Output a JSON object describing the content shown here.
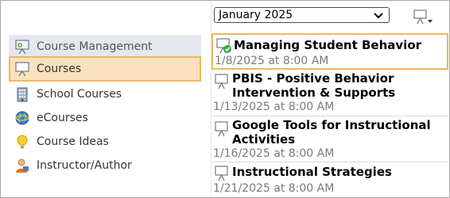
{
  "nav": {
    "header": "Course Management",
    "items": [
      "Courses",
      "School Courses",
      "eCourses",
      "Course Ideas",
      "Instructor/Author"
    ]
  },
  "toolbar": {
    "month_value": "January 2025"
  },
  "courses": [
    {
      "title": "Managing Student Behavior",
      "date": "1/8/2025 at 8:00 AM"
    },
    {
      "title": "PBIS - Positive Behavior Intervention & Supports",
      "date": "1/13/2025 at 8:00 AM"
    },
    {
      "title": "Google Tools for Instructional Activities",
      "date": "1/16/2025 at 8:00 AM"
    },
    {
      "title": "Instructional Strategies",
      "date": "1/21/2025 at 8:00 AM"
    }
  ],
  "colors": {
    "selection_fill": "#fbe1bd",
    "selection_border": "#efb75a",
    "header_fill": "#e4e7ee",
    "date_text": "#7a7a7a"
  },
  "icons": {
    "header": "easel-gear-icon",
    "courses": "easel-icon",
    "school_courses": "building-icon",
    "ecourses": "globe-icon",
    "course_ideas": "lightbulb-icon",
    "instructor": "person-icon",
    "course": "easel-icon",
    "course_selected": "easel-check-icon"
  }
}
